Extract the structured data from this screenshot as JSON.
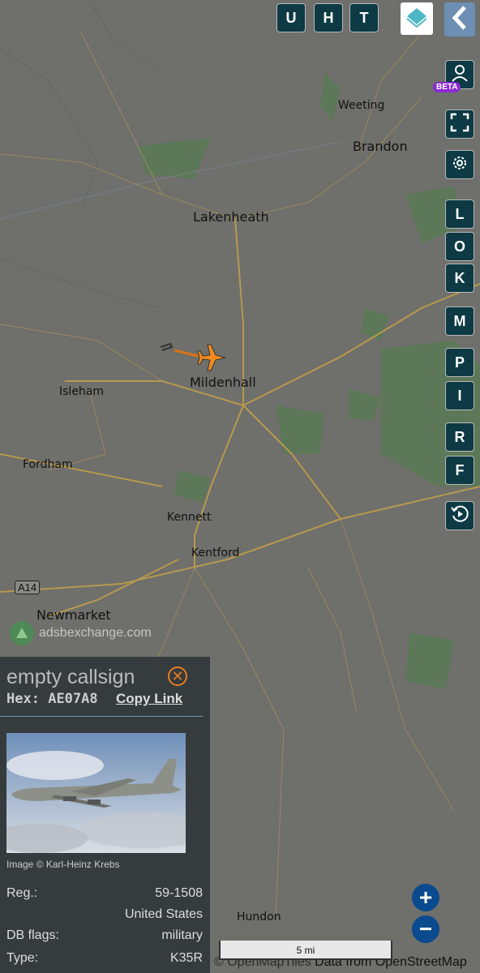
{
  "map": {
    "places": [
      {
        "name": "Weeting",
        "size": "small"
      },
      {
        "name": "Brandon",
        "size": "big"
      },
      {
        "name": "Lakenheath",
        "size": "big"
      },
      {
        "name": "Isleham",
        "size": "small"
      },
      {
        "name": "Mildenhall",
        "size": "big"
      },
      {
        "name": "Fordham",
        "size": "small"
      },
      {
        "name": "Kennett",
        "size": "small"
      },
      {
        "name": "Kentford",
        "size": "small"
      },
      {
        "name": "Newmarket",
        "size": "big"
      },
      {
        "name": "Hundon",
        "size": "small"
      }
    ],
    "road_shield": "A14",
    "watermark": "adsbexchange.com",
    "scale_label": "5 mi",
    "attribution_prefix": "© OpenMapTiles",
    "attribution_data": "Data from OpenStreetMap",
    "aircraft_color": "#f08a1e"
  },
  "controls": {
    "top_buttons": [
      "U",
      "H",
      "T"
    ],
    "layers_icon": "layers-icon",
    "back_icon": "chevron-left-icon",
    "beta_badge": "BETA",
    "right_buttons": [
      "L",
      "O",
      "K",
      "M",
      "P",
      "I",
      "R",
      "F"
    ],
    "zoom_in": "+",
    "zoom_out": "−"
  },
  "panel": {
    "callsign": "empty callsign",
    "hex_label": "Hex:",
    "hex_value": "AE07A8",
    "copy_link": "Copy Link",
    "image_credit": "Image © Karl-Heinz Krebs",
    "reg_label": "Reg.:",
    "reg_value": "59-1508",
    "country": "United States",
    "db_flags_label": "DB flags:",
    "db_flags_value": "military",
    "type_label": "Type:",
    "type_value": "K35R"
  }
}
